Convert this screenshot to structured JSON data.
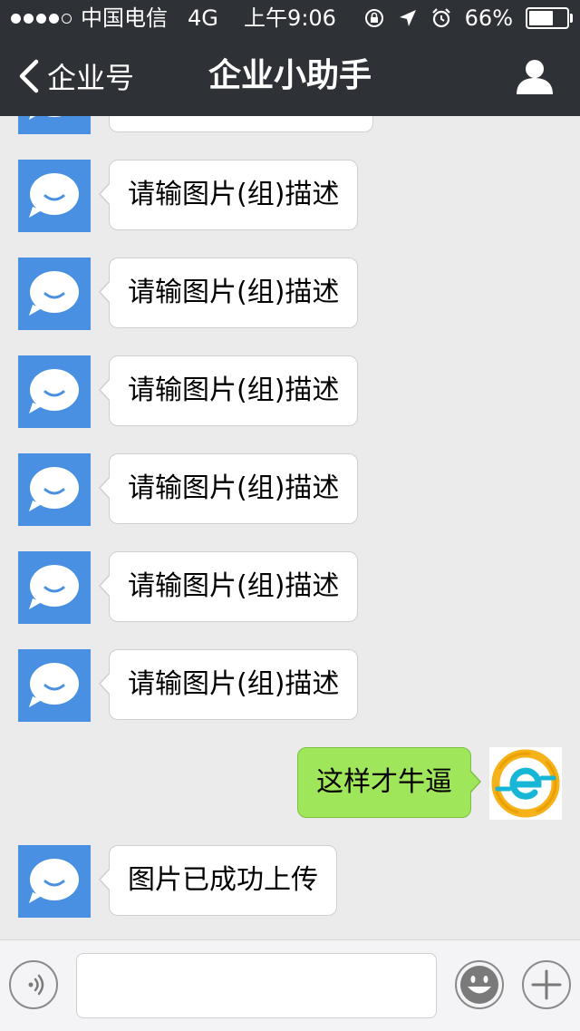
{
  "status_bar": {
    "carrier": "中国电信",
    "network": "4G",
    "time": "上午9:06",
    "battery": "66%",
    "battery_level": 0.66
  },
  "header": {
    "back_label": "企业号",
    "title": "企业小助手"
  },
  "messages": [
    {
      "side": "left",
      "text": "请输图片(组)描述"
    },
    {
      "side": "left",
      "text": "请输图片(组)描述"
    },
    {
      "side": "left",
      "text": "请输图片(组)描述"
    },
    {
      "side": "left",
      "text": "请输图片(组)描述"
    },
    {
      "side": "left",
      "text": "请输图片(组)描述"
    },
    {
      "side": "left",
      "text": "请输图片(组)描述"
    },
    {
      "side": "right",
      "text": "这样才牛逼"
    },
    {
      "side": "left",
      "text": "图片已成功上传"
    }
  ],
  "input_bar": {
    "voice_icon": "voice-icon",
    "emoji_icon": "emoji-icon",
    "plus_icon": "plus-icon",
    "text_value": ""
  },
  "colors": {
    "header_bg": "#2e3135",
    "chat_bg": "#ebebeb",
    "bot_avatar": "#4a90e2",
    "sent_bubble": "#9fe65a"
  }
}
